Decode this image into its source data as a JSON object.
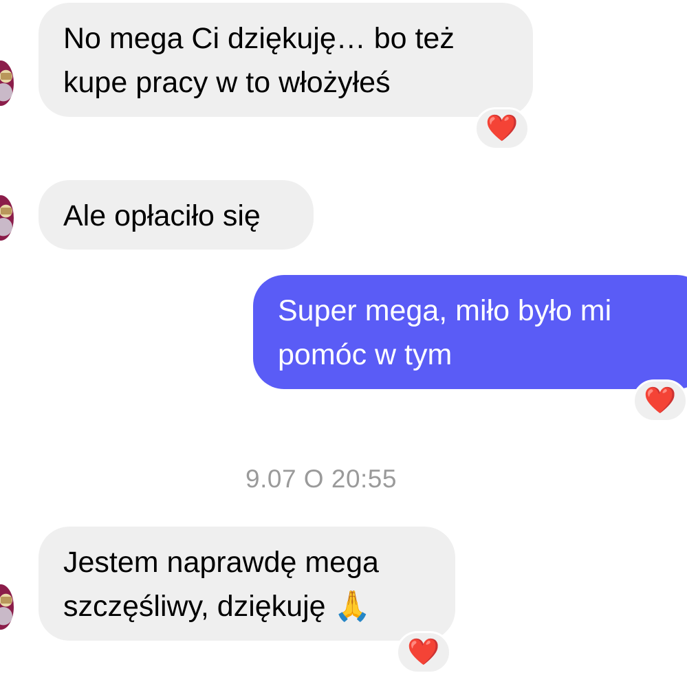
{
  "messages": [
    {
      "id": "m1",
      "direction": "incoming",
      "text": "No mega Ci dziękuję… bo też\nkupe pracy w to włożyłeś",
      "reaction": "❤️"
    },
    {
      "id": "m2",
      "direction": "incoming",
      "text": "Ale opłaciło się"
    },
    {
      "id": "m3",
      "direction": "outgoing",
      "text": "Super mega, miło było mi\npomóc w tym",
      "reaction": "❤️"
    },
    {
      "id": "m4",
      "direction": "incoming",
      "text": "Jestem naprawdę mega\nszczęśliwy, dziękuję 🙏",
      "reaction": "❤️"
    }
  ],
  "timestamp": "9.07 O 20:55",
  "colors": {
    "incoming_bubble": "#efefef",
    "outgoing_bubble": "#5a5cf6",
    "timestamp": "#9a9a9a",
    "heart": "#e0233b"
  },
  "icons": {
    "reaction": "red-heart-icon",
    "avatar": "contact-avatar"
  }
}
